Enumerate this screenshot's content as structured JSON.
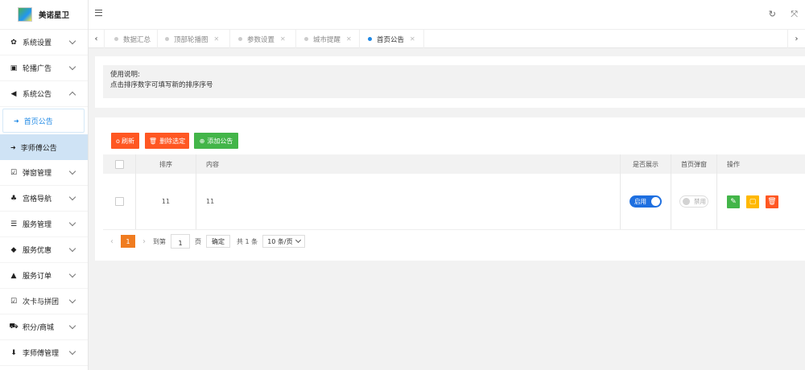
{
  "app": {
    "title": "美诺星卫"
  },
  "sidebar": {
    "items": [
      {
        "icon": "gear-icon",
        "label": "系统设置",
        "expanded": false
      },
      {
        "icon": "image-icon",
        "label": "轮播广告",
        "expanded": false
      },
      {
        "icon": "volume-icon",
        "label": "系统公告",
        "expanded": true,
        "children": [
          {
            "label": "首页公告",
            "active": true
          },
          {
            "label": "李师傅公告",
            "active": false
          }
        ]
      },
      {
        "icon": "checkbox-icon",
        "label": "弹窗管理",
        "expanded": false
      },
      {
        "icon": "sitemap-icon",
        "label": "宫格导航",
        "expanded": false
      },
      {
        "icon": "list-icon",
        "label": "服务管理",
        "expanded": false
      },
      {
        "icon": "tag-icon",
        "label": "服务优惠",
        "expanded": false
      },
      {
        "icon": "binoculars-icon",
        "label": "服务订单",
        "expanded": false
      },
      {
        "icon": "checkbox-icon",
        "label": "次卡与拼团",
        "expanded": false
      },
      {
        "icon": "cart-icon",
        "label": "积分/商城",
        "expanded": false
      },
      {
        "icon": "download-icon",
        "label": "李师傅管理",
        "expanded": false
      }
    ]
  },
  "tabs": [
    {
      "label": "数据汇总",
      "closable": false,
      "active": false
    },
    {
      "label": "顶部轮播图",
      "closable": true,
      "active": false
    },
    {
      "label": "参数设置",
      "closable": true,
      "active": false
    },
    {
      "label": "城市提醒",
      "closable": true,
      "active": false
    },
    {
      "label": "首页公告",
      "closable": true,
      "active": true
    }
  ],
  "notice": {
    "line1": "使用说明:",
    "line2": "点击排序数字可填写新的排序序号"
  },
  "toolbar": {
    "refresh": "刷新",
    "delete_selected": "删除选定",
    "add": "添加公告"
  },
  "table": {
    "columns": [
      "排序",
      "内容",
      "是否展示",
      "首页弹窗",
      "操作"
    ],
    "rows": [
      {
        "sort": "11",
        "content": "11",
        "show": "启用",
        "popup": "禁用"
      }
    ]
  },
  "pagination": {
    "current_page": "1",
    "goto_label": "到第",
    "goto_value": "1",
    "page_unit": "页",
    "confirm": "确定",
    "total": "共 1 条",
    "page_size": "10 条/页"
  },
  "colors": {
    "primary": "#1e88e5",
    "danger": "#ff5722",
    "success": "#43b549",
    "warning": "#ffb800",
    "pager_active": "#f07c20"
  }
}
